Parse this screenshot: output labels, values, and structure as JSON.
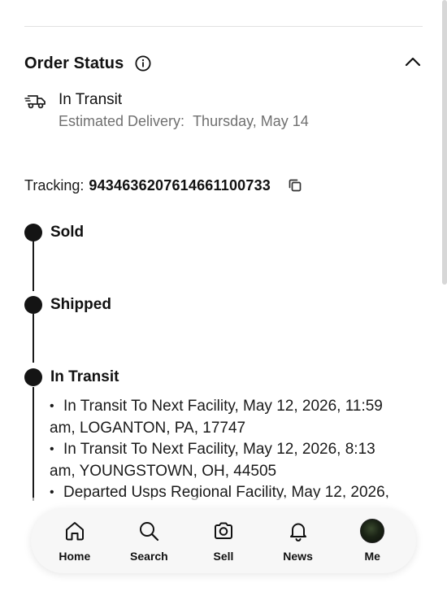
{
  "order_status": {
    "title": "Order Status",
    "info_icon": "info-icon",
    "collapse_icon": "chevron-up-icon",
    "current_status": "In Transit",
    "eta_label": "Estimated Delivery:",
    "eta_value": "Thursday, May 14",
    "status_icon": "truck-icon"
  },
  "tracking": {
    "label": "Tracking:",
    "number": "9434636207614661100733",
    "copy_icon": "copy-icon"
  },
  "timeline": {
    "steps": [
      {
        "label": "Sold"
      },
      {
        "label": "Shipped"
      },
      {
        "label": "In Transit"
      }
    ],
    "events": [
      {
        "text": "In Transit To Next Facility, May 12, 2026, 11:59",
        "text2": "am, LOGANTON, PA, 17747"
      },
      {
        "text": "In Transit To Next Facility, May 12, 2026, 8:13",
        "text2": "am, YOUNGSTOWN, OH, 44505"
      },
      {
        "text": "Departed Usps Regional Facility, May 12, 2026,",
        "text2": ""
      }
    ]
  },
  "bottom_nav": {
    "items": [
      {
        "label": "Home",
        "icon": "home-icon"
      },
      {
        "label": "Search",
        "icon": "search-icon"
      },
      {
        "label": "Sell",
        "icon": "camera-icon"
      },
      {
        "label": "News",
        "icon": "bell-icon"
      },
      {
        "label": "Me",
        "icon": "avatar"
      }
    ]
  },
  "colors": {
    "text_primary": "#111111",
    "text_secondary": "#707070",
    "divider": "#e2e2e2",
    "timeline": "#141414",
    "nav_background": "#f7f7f7"
  }
}
